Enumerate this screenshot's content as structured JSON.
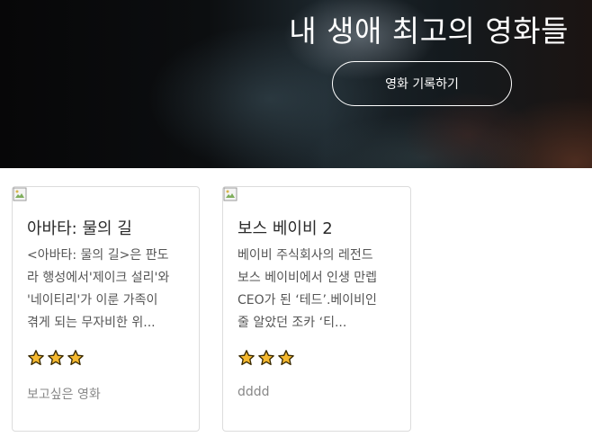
{
  "hero": {
    "title": "내 생애 최고의 영화들",
    "button_label": "영화 기록하기"
  },
  "movies": [
    {
      "title": "아바타: 물의 길",
      "description_lines": [
        "<아바타: 물의 길>은 판도",
        "라 행성에서'제이크 설리'와",
        "'네이티리'가 이룬 가족이",
        "겪게 되는 무자비한 위..."
      ],
      "rating": 3,
      "comment": "보고싶은 영화",
      "image_alt": ""
    },
    {
      "title": "보스 베이비 2",
      "description_lines": [
        "베이비 주식회사의 레전드",
        "보스 베이비에서 인생 만렙",
        "CEO가 된 ‘테드’.베이비인",
        "줄 알았던 조카 ‘티..."
      ],
      "rating": 3,
      "comment": "dddd",
      "image_alt": ""
    }
  ],
  "colors": {
    "star_fill": "#f5b82e",
    "star_stroke": "#3a2a00"
  }
}
